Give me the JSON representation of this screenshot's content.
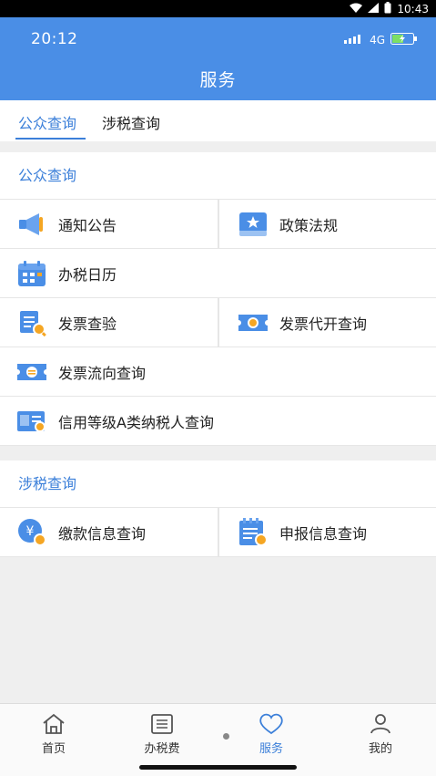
{
  "system_bar": {
    "time": "10:43"
  },
  "header": {
    "time": "20:12",
    "network": "4G",
    "title": "服务"
  },
  "tabs": [
    {
      "label": "公众查询",
      "active": true
    },
    {
      "label": "涉税查询",
      "active": false
    }
  ],
  "sections": [
    {
      "title": "公众查询",
      "items": [
        {
          "label": "通知公告",
          "icon": "megaphone-icon"
        },
        {
          "label": "政策法规",
          "icon": "policy-book-icon"
        },
        {
          "label": "办税日历",
          "icon": "calendar-icon"
        },
        {
          "label": "发票查验",
          "icon": "invoice-check-icon"
        },
        {
          "label": "发票代开查询",
          "icon": "invoice-issue-icon"
        },
        {
          "label": "发票流向查询",
          "icon": "invoice-flow-icon"
        },
        {
          "label": "信用等级A类纳税人查询",
          "icon": "credit-search-icon"
        }
      ]
    },
    {
      "title": "涉税查询",
      "items": [
        {
          "label": "缴款信息查询",
          "icon": "payment-search-icon"
        },
        {
          "label": "申报信息查询",
          "icon": "declaration-search-icon"
        }
      ]
    }
  ],
  "bottom_nav": [
    {
      "label": "首页",
      "icon": "home-icon",
      "active": false
    },
    {
      "label": "办税费",
      "icon": "list-icon",
      "active": false
    },
    {
      "label": "服务",
      "icon": "heart-icon",
      "active": true
    },
    {
      "label": "我的",
      "icon": "user-icon",
      "active": false
    }
  ],
  "colors": {
    "brand": "#4a8ee6",
    "accent": "#3b7fd9",
    "icon_blue": "#4a8ee6",
    "icon_orange": "#f5a623"
  }
}
